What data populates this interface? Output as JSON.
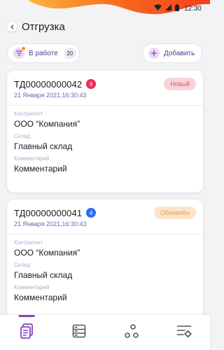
{
  "status_bar": {
    "time": "12:30"
  },
  "header": {
    "title": "Отгрузка"
  },
  "filters": {
    "work_label": "В работе",
    "work_count": "20",
    "add_label": "Добавить"
  },
  "labels": {
    "counterparty": "Контрагент",
    "warehouse": "Склад",
    "comment": "Комментарий"
  },
  "cards": [
    {
      "number": "ТД00000000042",
      "badge": "9",
      "badge_color": "#f0285a",
      "date": "21 Января 2021,16:30:43",
      "status": "Новый",
      "status_bg": "#f8d3da",
      "status_color": "#d65a72",
      "counterparty": "ООО “Компания”",
      "warehouse": "Главный склад",
      "comment": "Комментарий"
    },
    {
      "number": "ТД00000000041",
      "badge": "4",
      "badge_color": "#2f6bf2",
      "date": "21 Января 2021,16:30:43",
      "status": "Обновлён",
      "status_bg": "#fde3cc",
      "status_color": "#ee9a55",
      "counterparty": "ООО “Компания”",
      "warehouse": "Главный склад",
      "comment": "Комментарий"
    }
  ],
  "colors": {
    "accent": "#8a3fc4",
    "brand_orange": "#f7651e"
  },
  "nav": [
    {
      "icon": "documents-icon",
      "active": true
    },
    {
      "icon": "storage-icon",
      "active": false
    },
    {
      "icon": "nodes-icon",
      "active": false
    },
    {
      "icon": "settings-list-icon",
      "active": false
    }
  ]
}
